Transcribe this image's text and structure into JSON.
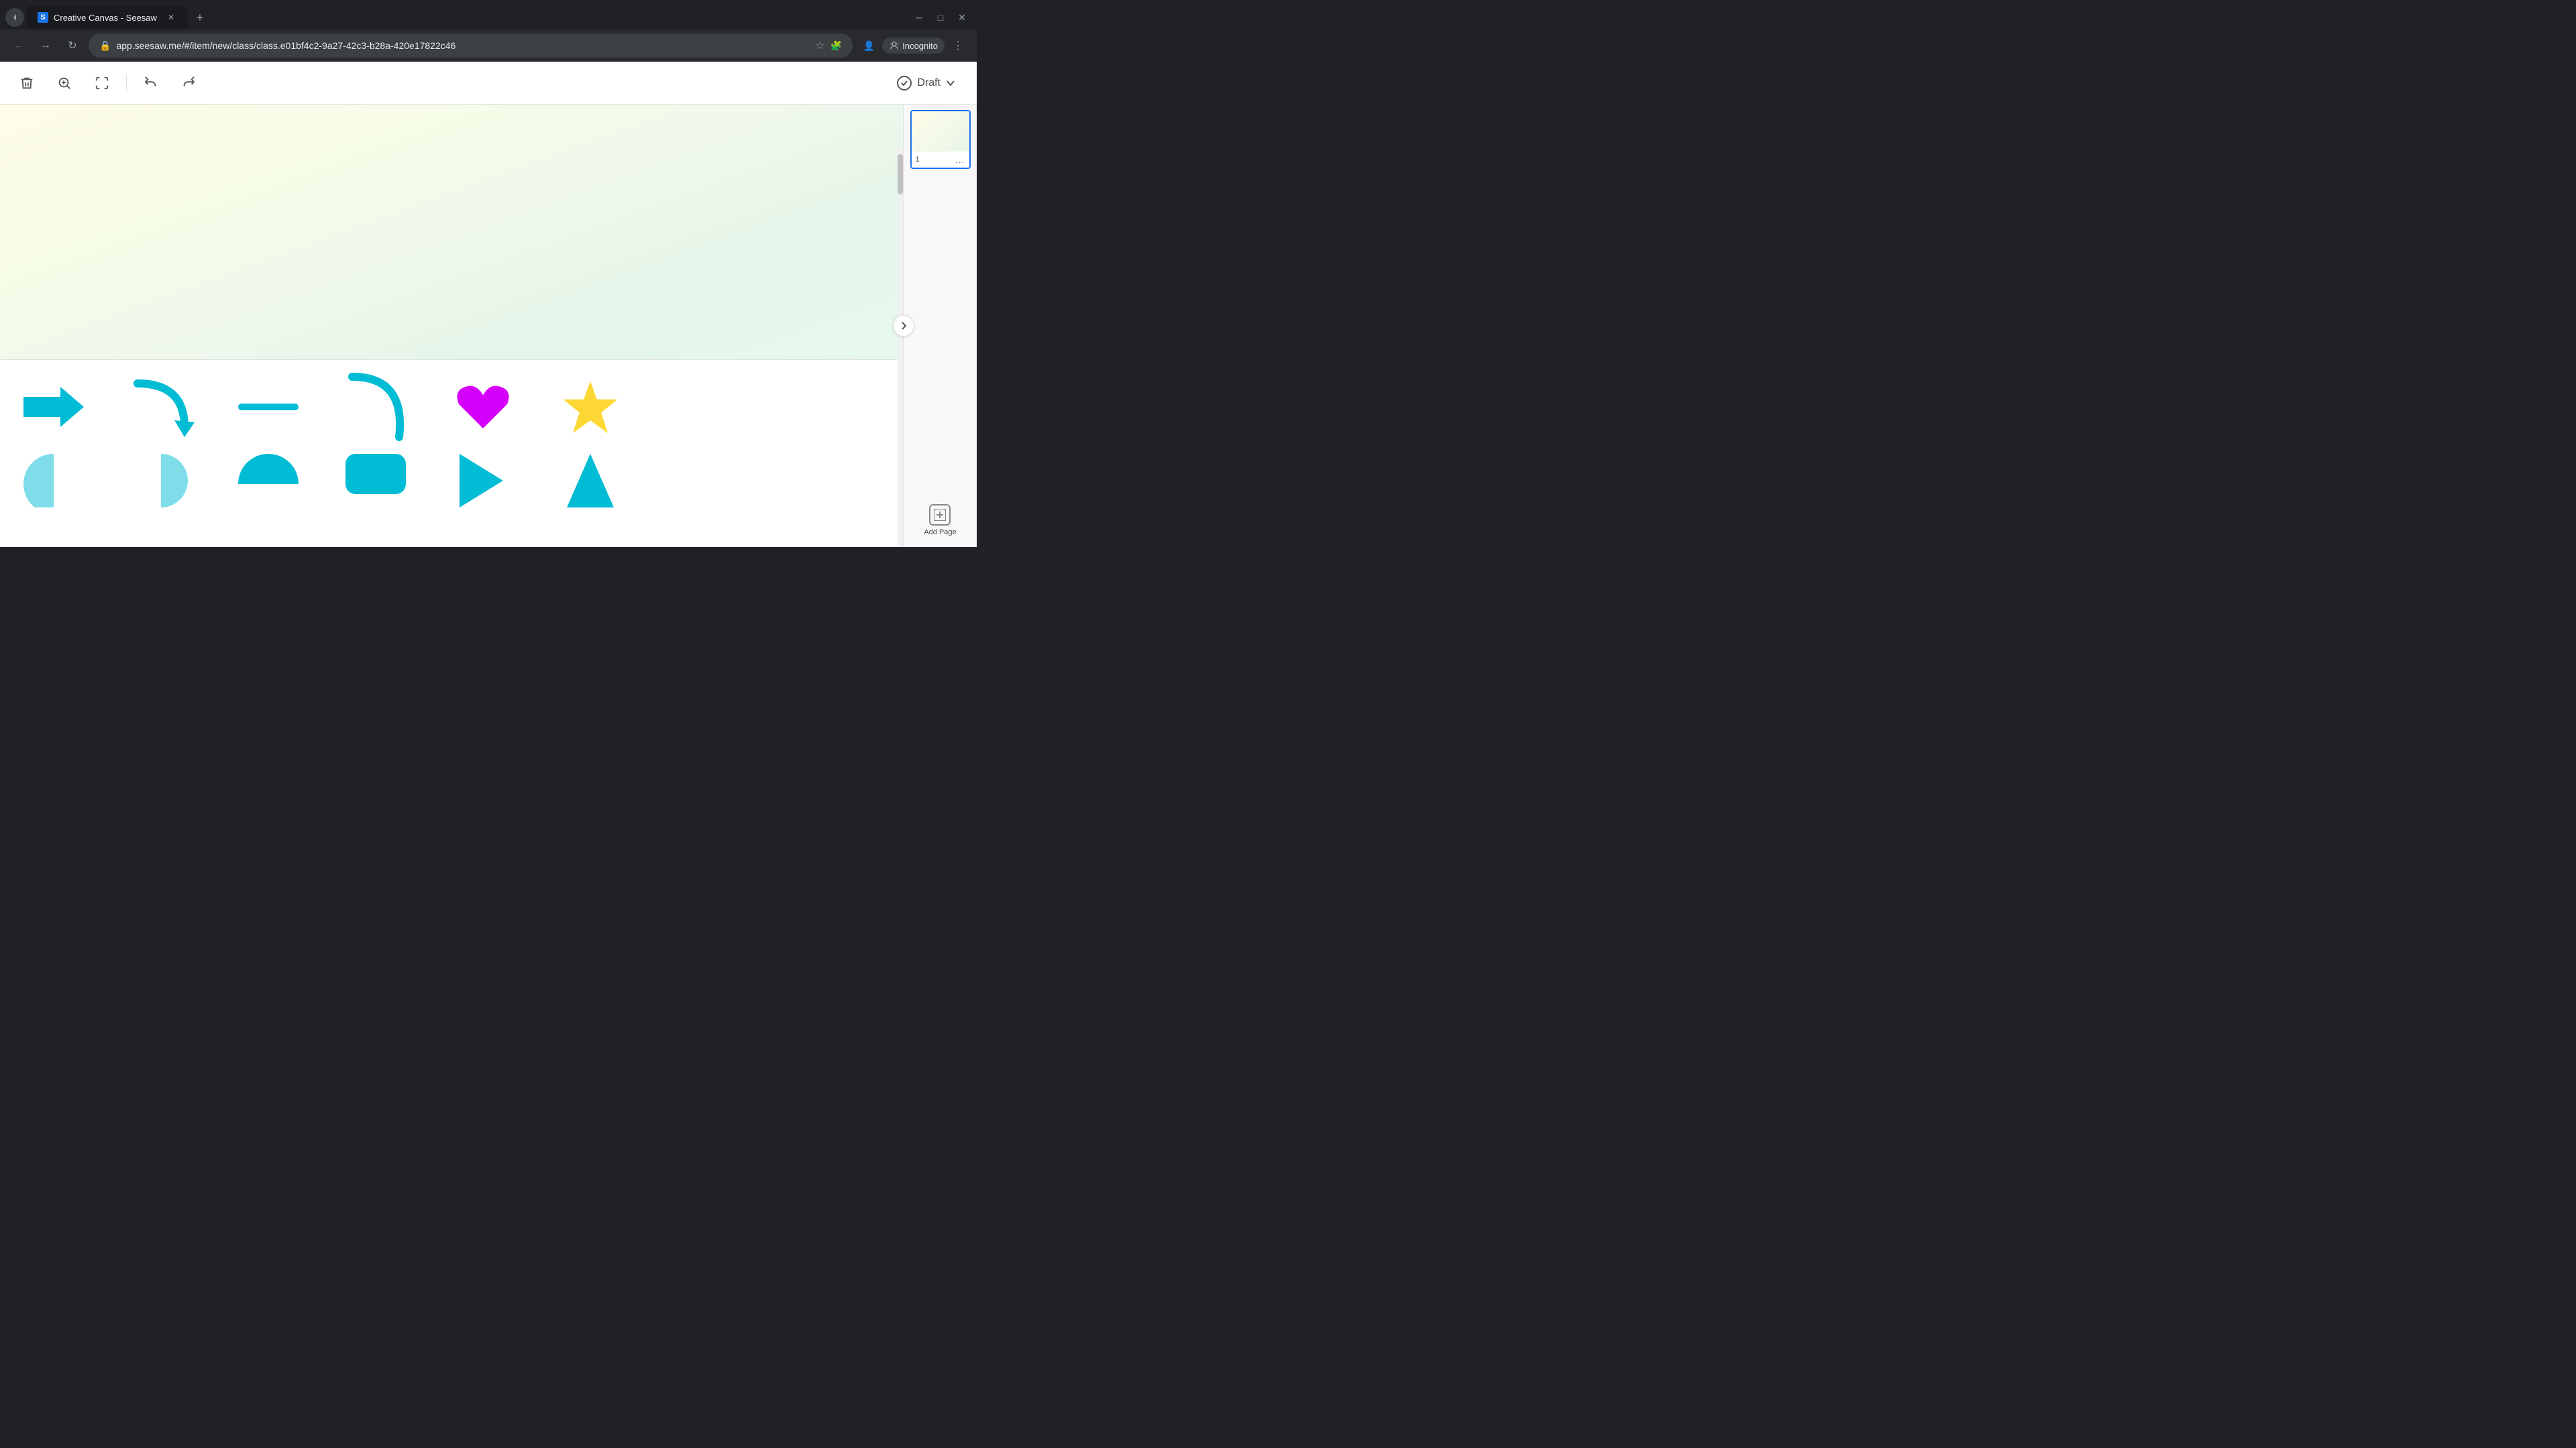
{
  "browser": {
    "tab_title": "Creative Canvas - Seesaw",
    "tab_favicon": "S",
    "url": "app.seesaw.me/#/item/new/class/class.e01bf4c2-9a27-42c3-b28a-420e17822c46",
    "new_tab_icon": "+",
    "window_controls": {
      "minimize": "─",
      "maximize": "□",
      "close": "✕"
    },
    "nav": {
      "back": "←",
      "forward": "→",
      "refresh": "↻"
    },
    "address_icons": {
      "star": "☆",
      "extensions": "🧩",
      "profile": "👤",
      "incognito": "Incognito",
      "menu": "⋮"
    }
  },
  "toolbar": {
    "delete_label": "🗑",
    "zoom_in_label": "⊕",
    "fullscreen_label": "⛶",
    "undo_label": "↩",
    "redo_label": "↪",
    "draft_label": "Draft",
    "draft_chevron": "⌄"
  },
  "canvas": {
    "background_colors": [
      "#fffde7",
      "#f1f8e9",
      "#e8f5e9"
    ]
  },
  "shapes": {
    "row1": [
      {
        "id": "arrow-right",
        "label": "Arrow Right"
      },
      {
        "id": "arrow-curved-down",
        "label": "Arrow Curved Down"
      },
      {
        "id": "line",
        "label": "Line"
      },
      {
        "id": "arc",
        "label": "Arc"
      },
      {
        "id": "heart",
        "label": "Heart"
      },
      {
        "id": "star",
        "label": "Star"
      }
    ],
    "row2": [
      {
        "id": "circle-half-left",
        "label": "Half Circle"
      },
      {
        "id": "circle-half-right",
        "label": "Half Circle 2"
      },
      {
        "id": "semicircle-top",
        "label": "Semicircle"
      },
      {
        "id": "rounded-rect",
        "label": "Rounded Rectangle"
      },
      {
        "id": "triangle-right",
        "label": "Triangle"
      },
      {
        "id": "triangle-up",
        "label": "Triangle Up"
      }
    ]
  },
  "sidebar": {
    "page_number": "1",
    "more_label": "...",
    "add_page_label": "Add Page",
    "toggle_icon": "›"
  }
}
